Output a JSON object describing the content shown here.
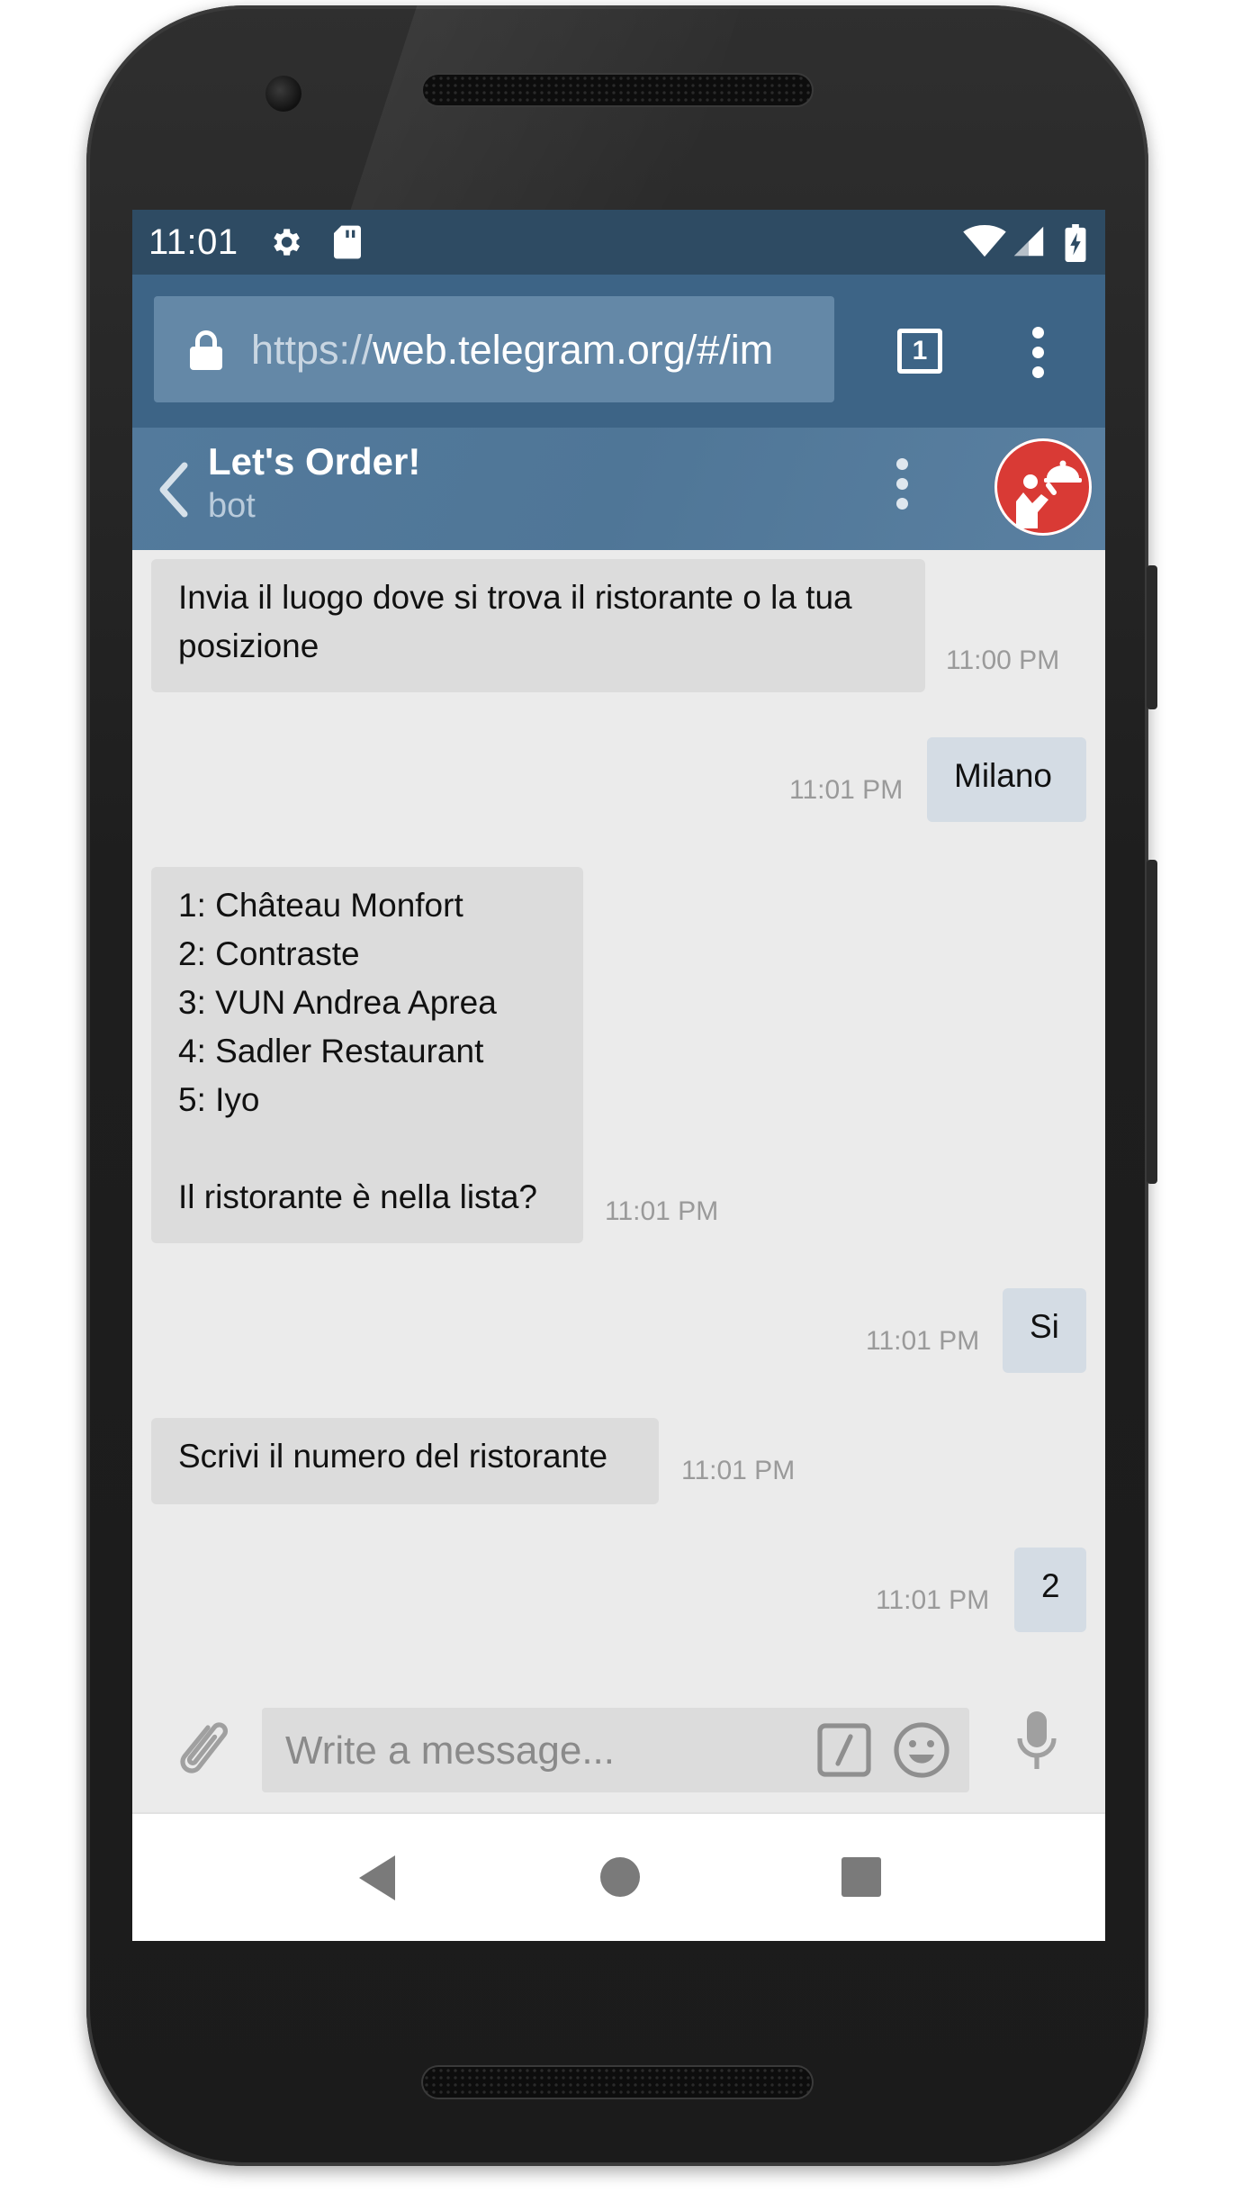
{
  "status_bar": {
    "time": "11:01",
    "icons": [
      "gear-icon",
      "sd-card-icon",
      "wifi-icon",
      "signal-icon",
      "battery-charging-icon"
    ]
  },
  "browser": {
    "url_scheme": "https://",
    "url_rest": "web.telegram.org/#/im",
    "tab_count": "1",
    "icons": [
      "lock-icon",
      "tabs-icon",
      "more-vert-icon"
    ]
  },
  "chat": {
    "title": "Let's Order!",
    "subtitle": "bot",
    "icons": [
      "back-arrow-icon",
      "more-vert-icon",
      "avatar-waiter-icon"
    ]
  },
  "messages": [
    {
      "direction": "in",
      "text": "Invia il luogo dove si trova il ristorante o la tua\nposizione",
      "time": "11:00 PM"
    },
    {
      "direction": "out",
      "text": "Milano",
      "time": "11:01 PM"
    },
    {
      "direction": "in",
      "text": "1: Château Monfort\n2: Contraste\n3: VUN Andrea Aprea\n4: Sadler Restaurant\n5: Iyo\n\nIl ristorante è nella lista?",
      "time": "11:01 PM"
    },
    {
      "direction": "out",
      "text": "Si",
      "time": "11:01 PM"
    },
    {
      "direction": "in",
      "text": "Scrivi il numero del ristorante",
      "time": "11:01 PM"
    },
    {
      "direction": "out",
      "text": "2",
      "time": "11:01 PM"
    }
  ],
  "composer": {
    "placeholder": "Write a message...",
    "icons": [
      "paperclip-icon",
      "bot-command-icon",
      "emoji-icon",
      "microphone-icon"
    ]
  },
  "nav_bar": {
    "icons": [
      "nav-back-icon",
      "nav-home-icon",
      "nav-recents-icon"
    ]
  },
  "colors": {
    "status_bar": "#2e4b63",
    "url_bar": "#3d6486",
    "chat_header": "#537a9c",
    "bubble_in": "#dcdcdc",
    "bubble_out": "#d4dce4",
    "chat_background": "#ebebeb",
    "avatar": "#d93a35"
  }
}
